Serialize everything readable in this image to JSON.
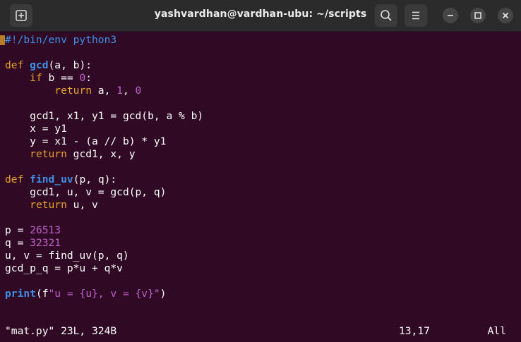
{
  "window": {
    "title": "yashvardhan@vardhan-ubu: ~/scripts"
  },
  "titlebar": {
    "new_tab_icon": "new-tab-icon",
    "search_icon": "search-icon",
    "menu_icon": "hamburger-menu-icon",
    "minimize_icon": "minimize-icon",
    "maximize_icon": "maximize-icon",
    "close_icon": "close-icon"
  },
  "colors": {
    "background": "#300a24",
    "keyword": "#e6a22a",
    "function_name": "#3f8fe8",
    "number": "#c061cb",
    "text": "#ffffff"
  },
  "code": {
    "l1": "#!/bin/env python3",
    "l3_kw": "def",
    "l3_fn": "gcd",
    "l3_rest": "(a, b):",
    "l4_kw": "if",
    "l4_mid": " b == ",
    "l4_num": "0",
    "l4_end": ":",
    "l5_kw": "return",
    "l5_mid": " a, ",
    "l5_n1": "1",
    "l5_sep": ", ",
    "l5_n2": "0",
    "l7": "gcd1, x1, y1 = gcd(b, a % b)",
    "l8": "x = y1",
    "l9": "y = x1 - (a // b) * y1",
    "l10_kw": "return",
    "l10_rest": " gcd1, x, y",
    "l12_kw": "def",
    "l12_fn": "find_uv",
    "l12_rest": "(p, q):",
    "l13": "gcd1, u, v = gcd(p, q)",
    "l14_kw": "return",
    "l14_rest": " u, v",
    "l16_pre": "p = ",
    "l16_num": "26513",
    "l17_pre": "q = ",
    "l17_num": "32321",
    "l18": "u, v = find_uv(p, q)",
    "l19": "gcd_p_q = p*u + q*v",
    "l21_fn": "print",
    "l21_open": "(f",
    "l21_str": "\"u = {u}, v = {v}\"",
    "l21_close": ")"
  },
  "status": {
    "file": "\"mat.py\" 23L, 324B",
    "position": "13,17",
    "scroll": "All"
  }
}
